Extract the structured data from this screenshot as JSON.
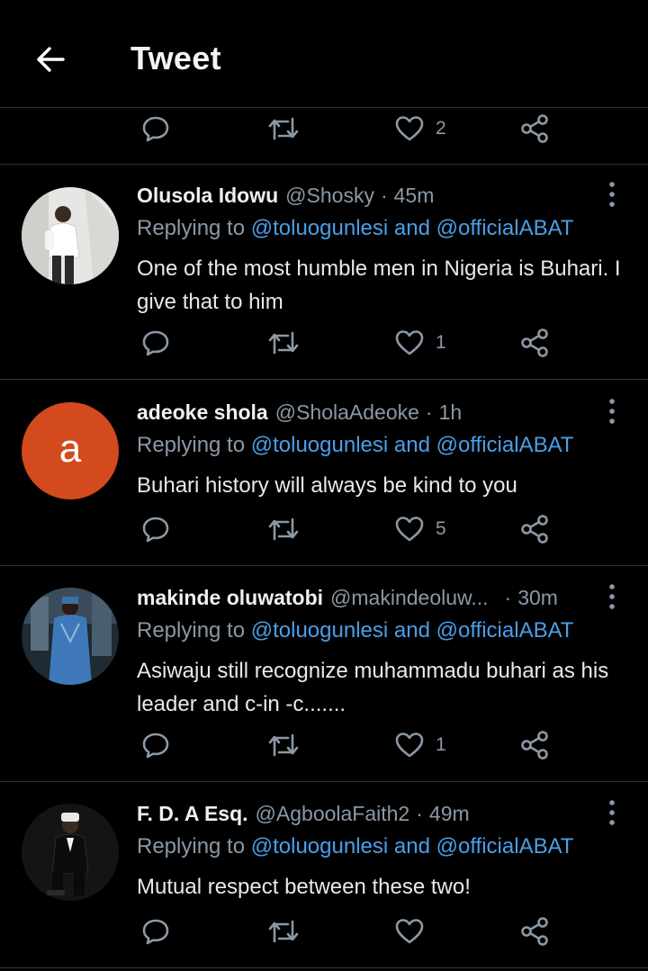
{
  "header": {
    "title": "Tweet"
  },
  "top_actions": {
    "like_count": "2"
  },
  "tweets": [
    {
      "name": "Olusola Idowu",
      "handle": "@Shosky",
      "dot": "·",
      "time": "45m",
      "replying_prefix": "Replying to",
      "replying_to": [
        "@toluogunlesi",
        "@officialABAT"
      ],
      "replying_and": "and",
      "text": "One of the most humble men in Nigeria is Buhari. I give that to him",
      "like_count": "1"
    },
    {
      "name": "adeoke shola",
      "handle": "@SholaAdeoke",
      "dot": "·",
      "time": "1h",
      "avatar_letter": "a",
      "avatar_color": "#d24a1e",
      "replying_prefix": "Replying to",
      "replying_to": [
        "@toluogunlesi",
        "@officialABAT"
      ],
      "replying_and": "and",
      "text": "Buhari history will always be kind to you",
      "like_count": "5"
    },
    {
      "name": "makinde oluwatobi",
      "handle": "@makindeoluw...",
      "dot": "·",
      "time": "30m",
      "replying_prefix": "Replying to",
      "replying_to": [
        "@toluogunlesi",
        "@officialABAT"
      ],
      "replying_and": "and",
      "text": "Asiwaju still recognize muhammadu buhari as his leader and c-in -c.......",
      "like_count": "1"
    },
    {
      "name": "F. D. A Esq.",
      "handle": "@AgboolaFaith2",
      "dot": "·",
      "time": "49m",
      "replying_prefix": "Replying to",
      "replying_to": [
        "@toluogunlesi",
        "@officialABAT"
      ],
      "replying_and": "and",
      "text": "Mutual respect between these two!",
      "like_count": ""
    }
  ],
  "colors": {
    "background": "#000000",
    "divider": "#2f3336",
    "secondary_text": "#8b98a5",
    "mention": "#4a9fe8"
  },
  "icons": [
    "back-arrow-icon",
    "reply-icon",
    "retweet-icon",
    "heart-icon",
    "share-icon",
    "more-vertical-icon"
  ]
}
